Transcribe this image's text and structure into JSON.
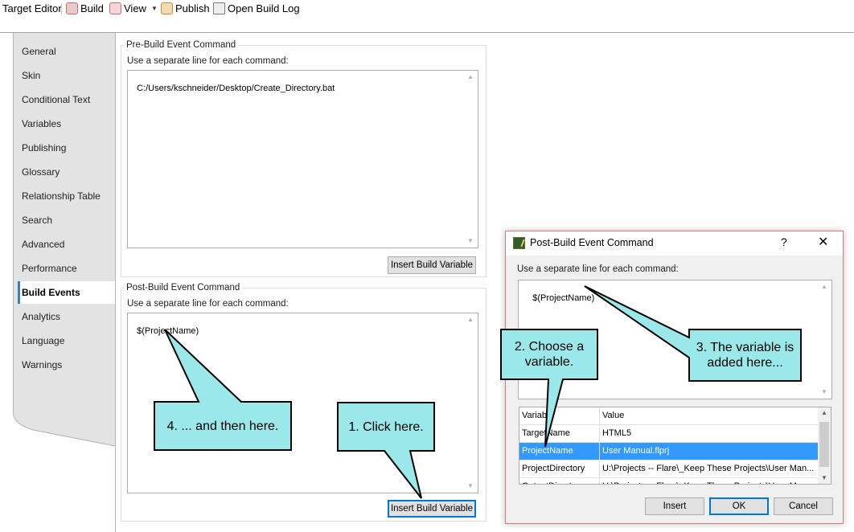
{
  "toolbar": {
    "tab_title": "Target Editor",
    "build": "Build",
    "view": "View",
    "publish": "Publish",
    "open_build_log": "Open Build Log"
  },
  "sidebar": {
    "items": [
      {
        "label": "General"
      },
      {
        "label": "Skin"
      },
      {
        "label": "Conditional Text"
      },
      {
        "label": "Variables"
      },
      {
        "label": "Publishing"
      },
      {
        "label": "Glossary"
      },
      {
        "label": "Relationship Table"
      },
      {
        "label": "Search"
      },
      {
        "label": "Advanced"
      },
      {
        "label": "Performance"
      },
      {
        "label": "Build Events",
        "active": true
      },
      {
        "label": "Analytics"
      },
      {
        "label": "Language"
      },
      {
        "label": "Warnings"
      }
    ]
  },
  "pre_build": {
    "legend": "Pre-Build Event Command",
    "hint": "Use a separate line for each command:",
    "command": "C:/Users/kschneider/Desktop/Create_Directory.bat",
    "insert_button": "Insert Build Variable"
  },
  "post_build": {
    "legend": "Post-Build Event Command",
    "hint": "Use a separate line for each command:",
    "command": "$(ProjectName)",
    "insert_button": "Insert Build Variable"
  },
  "dialog": {
    "title": "Post-Build Event Command",
    "help": "?",
    "close": "✕",
    "hint": "Use a separate line for each command:",
    "command": "$(ProjectName)",
    "columns": [
      "Variable",
      "Value"
    ],
    "rows": [
      {
        "variable": "TargetName",
        "value": "HTML5"
      },
      {
        "variable": "ProjectName",
        "value": "User Manual.flprj",
        "selected": true
      },
      {
        "variable": "ProjectDirectory",
        "value": "U:\\Projects -- Flare\\_Keep These Projects\\User Man..."
      },
      {
        "variable": "OutputDirectory",
        "value": "U:\\Projects -- Flare\\_Keep These Projects\\User Man..."
      }
    ],
    "insert": "Insert",
    "ok": "OK",
    "cancel": "Cancel"
  },
  "callouts": {
    "c1": "1. Click here.",
    "c2_line1": "2. Choose a",
    "c2_line2": "variable.",
    "c3_line1": "3. The variable is",
    "c3_line2": "added here...",
    "c4": "4. ... and then here."
  },
  "colors": {
    "callout_fill": "#9ae8ea",
    "selection": "#3399ff",
    "active_tab_border": "#3c7fb1"
  }
}
